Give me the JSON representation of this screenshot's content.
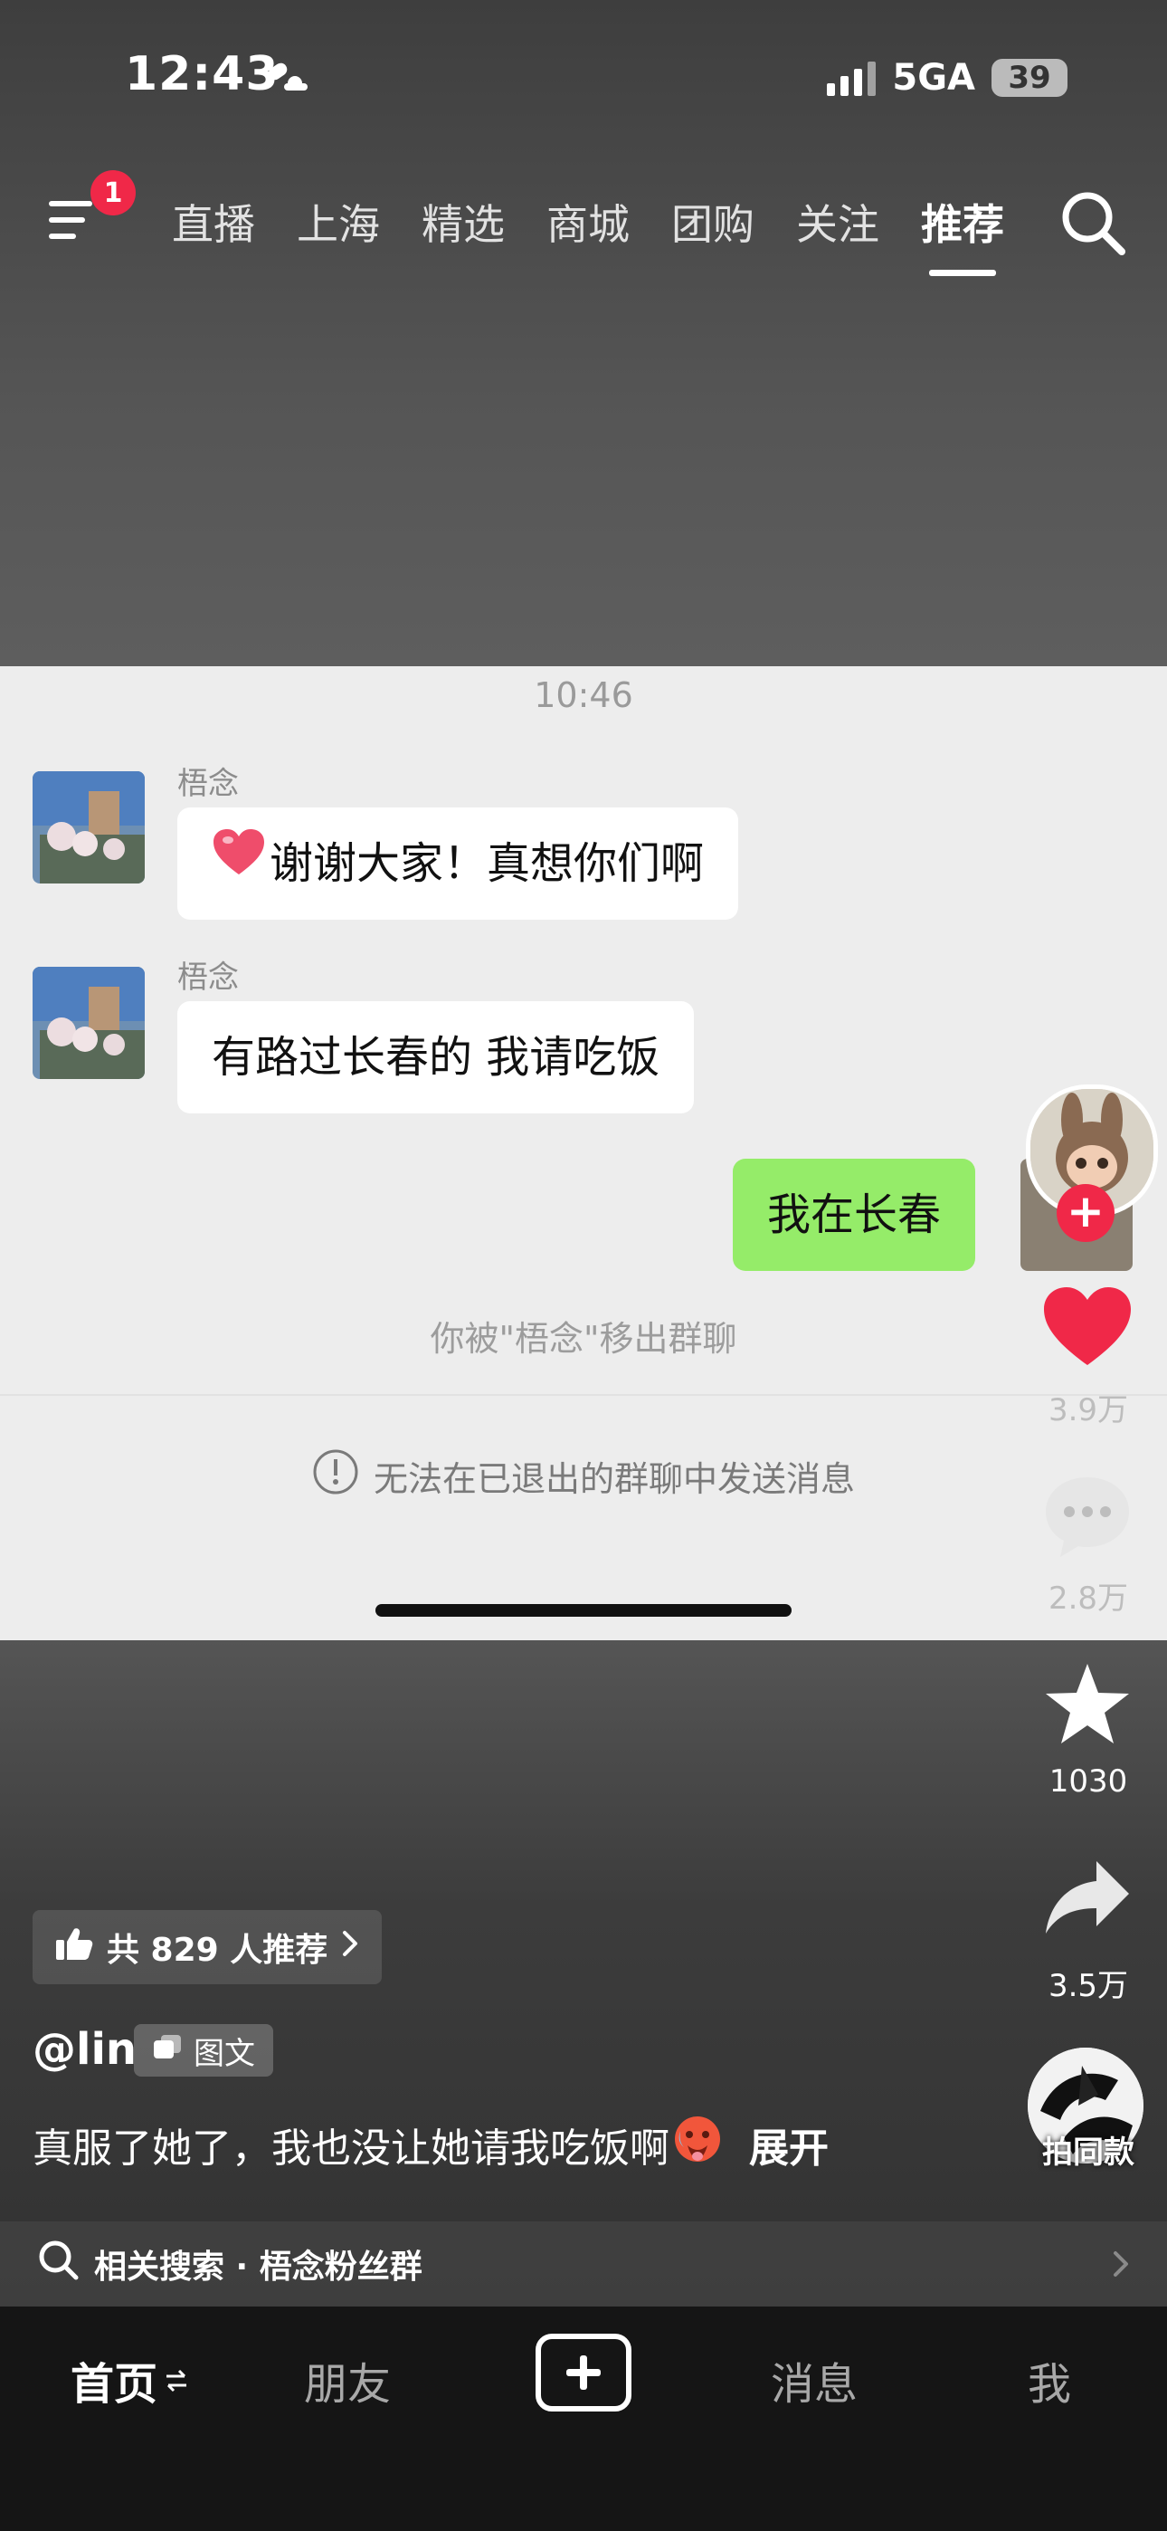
{
  "status_bar": {
    "time": "12:43",
    "network": "5GA",
    "battery": "39"
  },
  "top_nav": {
    "menu_badge": "1",
    "tabs": [
      "直播",
      "上海",
      "精选",
      "商城",
      "团购",
      "关注",
      "推荐"
    ],
    "active_tab": "推荐"
  },
  "chat": {
    "timestamp": "10:46",
    "messages": [
      {
        "sender": "梧念",
        "text": "谢谢大家！真想你们啊"
      },
      {
        "sender": "梧念",
        "text": "有路过长春的 我请吃饭"
      },
      {
        "sender": "",
        "text": "我在长春"
      }
    ],
    "system_removed": "你被\"梧念\"移出群聊",
    "system_cannot_send": "无法在已退出的群聊中发送消息"
  },
  "actions": {
    "likes": "3.9万",
    "comments": "2.8万",
    "favorites": "1030",
    "shares": "3.5万",
    "same_style": "拍同款"
  },
  "post": {
    "recommend_text": "共 829 人推荐",
    "author": "@lin",
    "type_label": "图文",
    "caption": "真服了她了，我也没让她请我吃饭啊",
    "expand_label": "展开",
    "related_search": "相关搜索 · 梧念粉丝群"
  },
  "bottom_nav": {
    "home": "首页",
    "friends": "朋友",
    "messages": "消息",
    "me": "我"
  },
  "colors": {
    "accent_red": "#f02848",
    "wechat_green": "#95ec69",
    "chat_bg": "#ededed"
  }
}
